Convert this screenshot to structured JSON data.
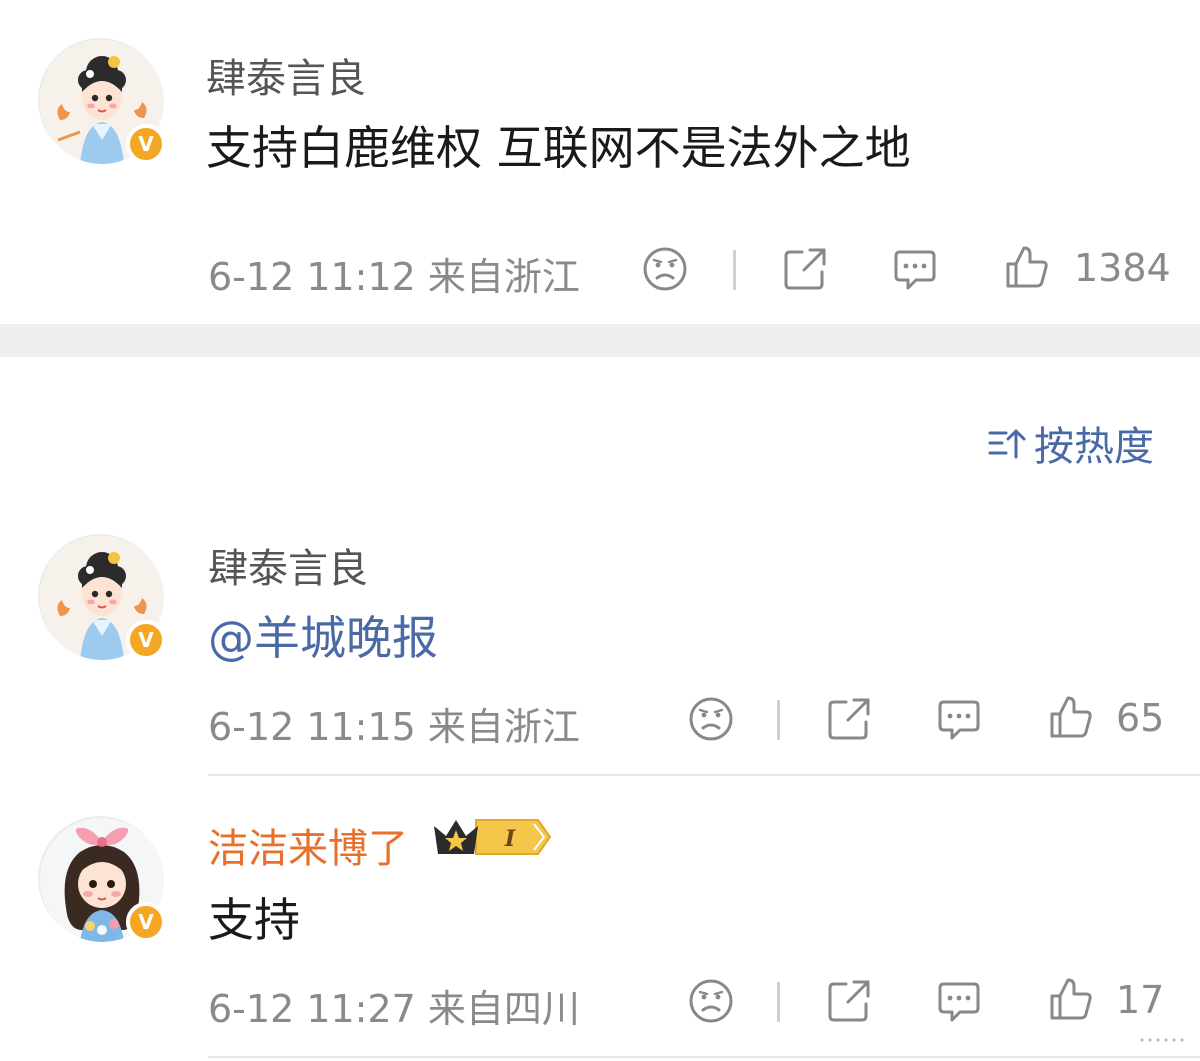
{
  "post": {
    "author": "肆泰言良",
    "text": "支持白鹿维权 互联网不是法外之地",
    "time": "6-12 11:12",
    "location": "来自浙江",
    "likes": "1384",
    "verified_badge": "V"
  },
  "sort": {
    "label": "按热度",
    "icon": "sort-hot-icon"
  },
  "comments": [
    {
      "author": "肆泰言良",
      "text": "@羊城晚报",
      "time": "6-12 11:15",
      "location": "来自浙江",
      "likes": "65",
      "verified_badge": "V"
    },
    {
      "author": "洁洁来博了",
      "text": "支持",
      "time": "6-12 11:27",
      "location": "来自四川",
      "likes": "17",
      "verified_badge": "V",
      "level_badge": "I"
    }
  ],
  "colors": {
    "accent_link": "#4a6aa6",
    "vip_name": "#e8702a",
    "meta": "#8a8a8a",
    "badge": "#f5a623"
  }
}
